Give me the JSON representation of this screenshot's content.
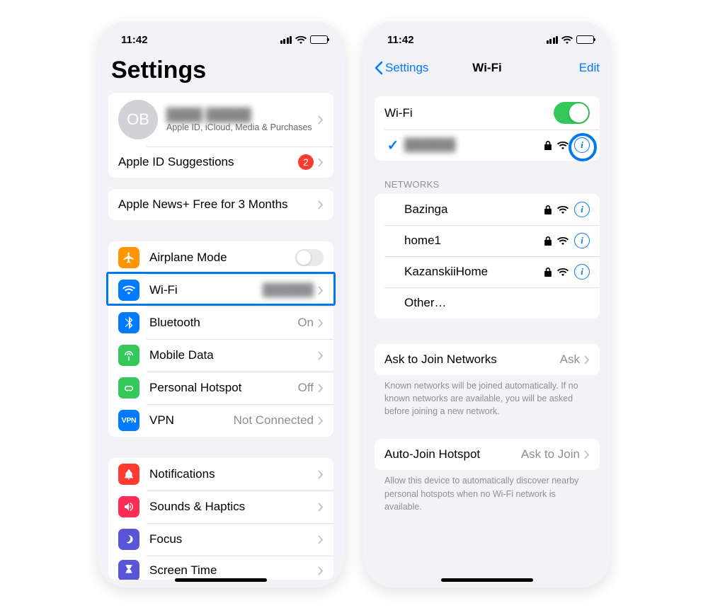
{
  "status": {
    "time": "11:42"
  },
  "left": {
    "title": "Settings",
    "profile": {
      "initials": "OB",
      "name_blurred": "████ █████",
      "subtitle": "Apple ID, iCloud, Media & Purchases"
    },
    "apple_id_suggestions": {
      "label": "Apple ID Suggestions",
      "badge": "2"
    },
    "promo": {
      "label": "Apple News+ Free for 3 Months"
    },
    "rows": {
      "airplane": {
        "label": "Airplane Mode"
      },
      "wifi": {
        "label": "Wi-Fi",
        "value_blurred": "██████"
      },
      "bluetooth": {
        "label": "Bluetooth",
        "value": "On"
      },
      "mobile_data": {
        "label": "Mobile Data"
      },
      "hotspot": {
        "label": "Personal Hotspot",
        "value": "Off"
      },
      "vpn": {
        "label": "VPN",
        "value": "Not Connected"
      },
      "notifications": {
        "label": "Notifications"
      },
      "sounds": {
        "label": "Sounds & Haptics"
      },
      "focus": {
        "label": "Focus"
      },
      "screen_time": {
        "label": "Screen Time"
      }
    }
  },
  "right": {
    "back": "Settings",
    "title": "Wi-Fi",
    "edit": "Edit",
    "wifi_toggle_label": "Wi-Fi",
    "connected_blurred": "██████",
    "networks_header": "Networks",
    "networks": [
      {
        "name": "Bazinga"
      },
      {
        "name": "home1"
      },
      {
        "name": "KazanskiiHome"
      }
    ],
    "other": "Other…",
    "ask_join": {
      "label": "Ask to Join Networks",
      "value": "Ask"
    },
    "ask_join_footer": "Known networks will be joined automatically. If no known networks are available, you will be asked before joining a new network.",
    "auto_join": {
      "label": "Auto-Join Hotspot",
      "value": "Ask to Join"
    },
    "auto_join_footer": "Allow this device to automatically discover nearby personal hotspots when no Wi-Fi network is available."
  }
}
